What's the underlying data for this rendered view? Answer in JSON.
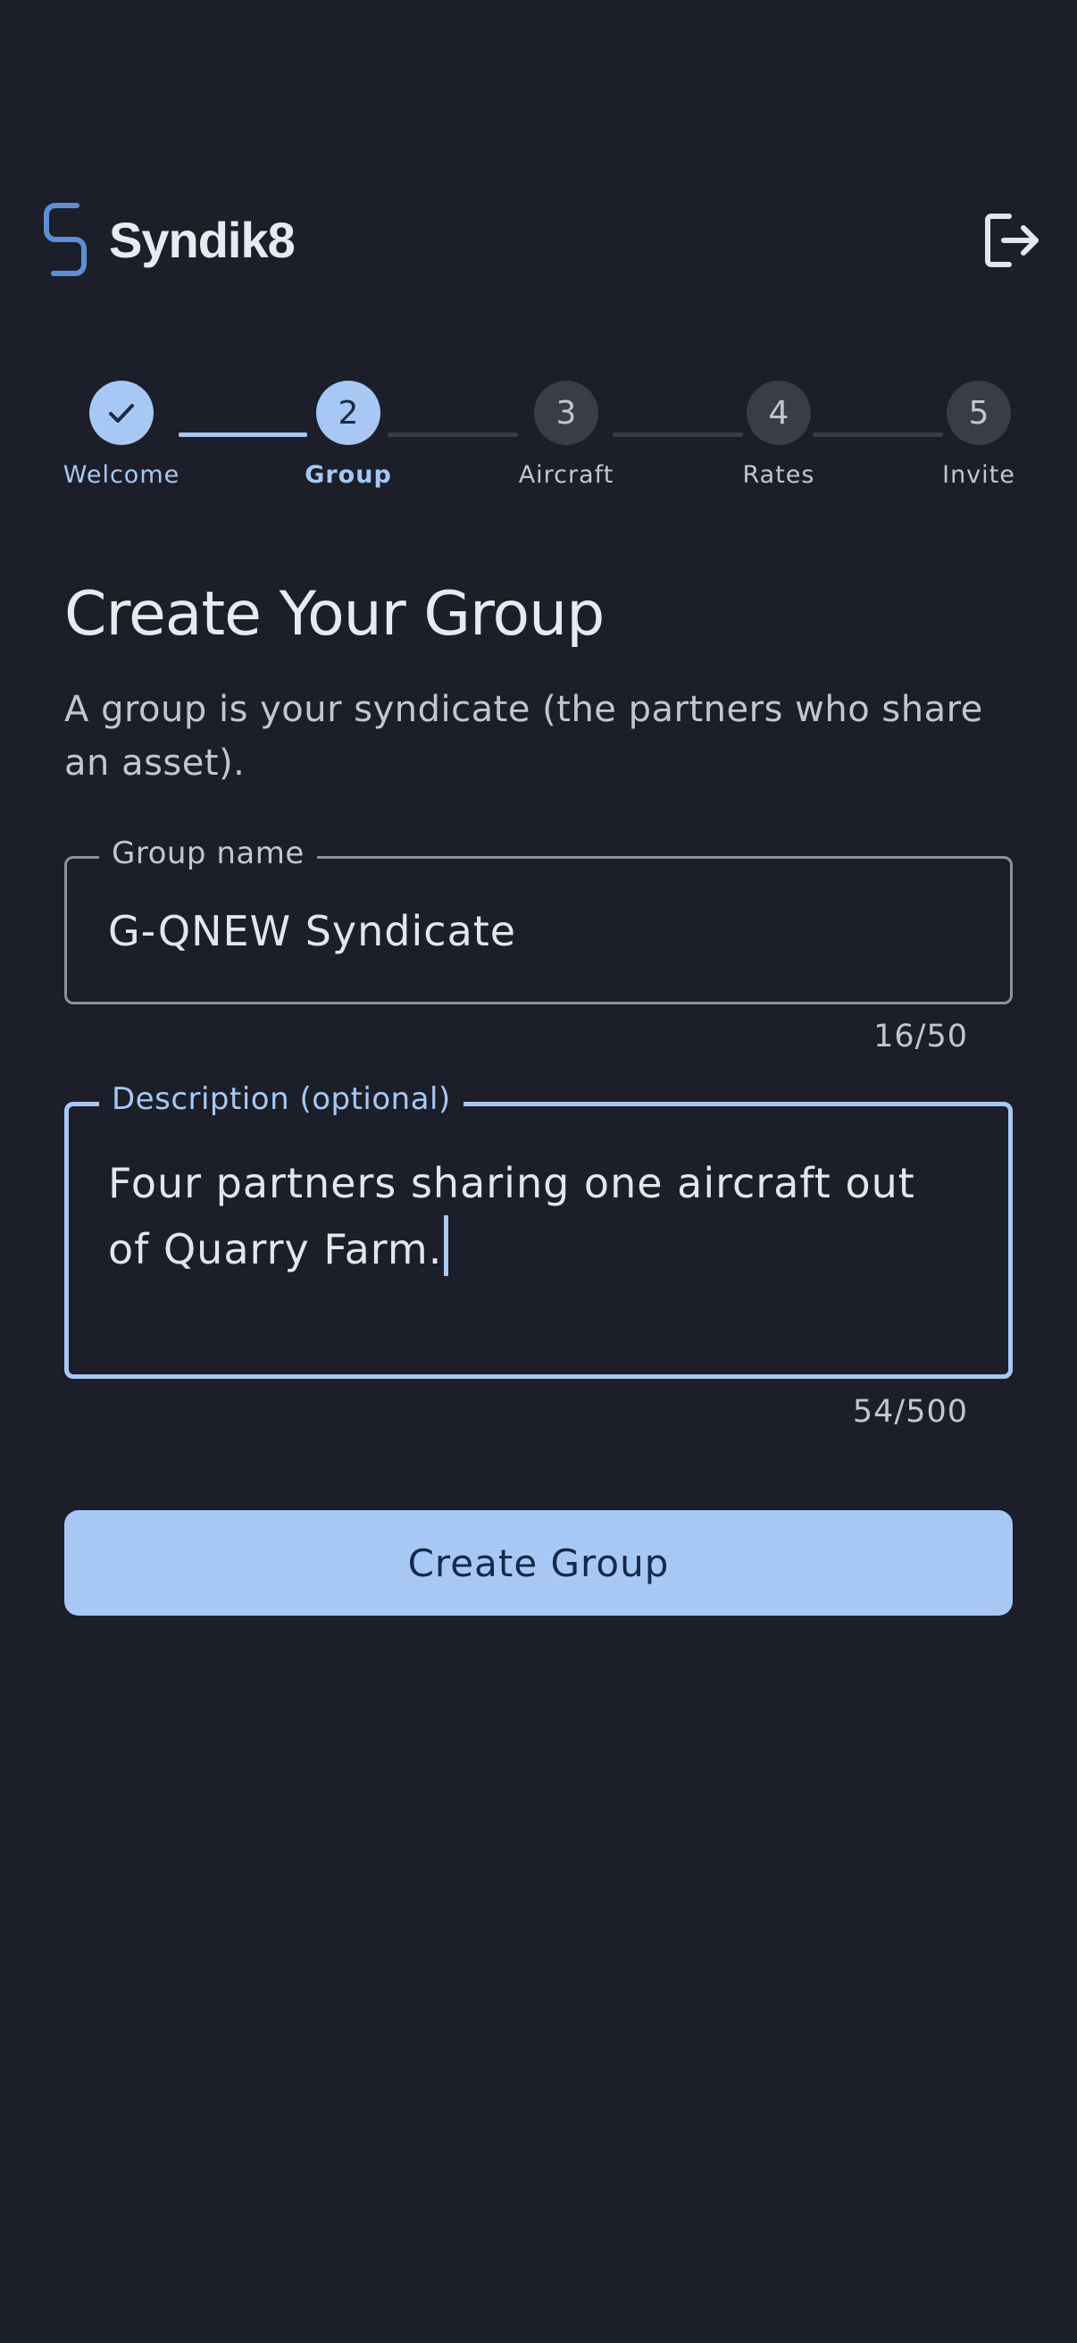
{
  "app": {
    "name": "Syndik8",
    "logo_icon": "chain-link-s-icon",
    "logout_icon": "logout-icon"
  },
  "stepper": {
    "steps": [
      {
        "label": "Welcome",
        "number": "",
        "state": "done"
      },
      {
        "label": "Group",
        "number": "2",
        "state": "active"
      },
      {
        "label": "Aircraft",
        "number": "3",
        "state": "pending"
      },
      {
        "label": "Rates",
        "number": "4",
        "state": "pending"
      },
      {
        "label": "Invite",
        "number": "5",
        "state": "pending"
      }
    ]
  },
  "page": {
    "title": "Create Your Group",
    "subtitle": "A group is your syndicate (the partners who share an asset)."
  },
  "form": {
    "group_name": {
      "label": "Group name",
      "value": "G-QNEW Syndicate",
      "counter": "16/50"
    },
    "description": {
      "label": "Description (optional)",
      "value": "Four partners sharing one aircraft out of Quarry Farm.",
      "counter": "54/500"
    },
    "submit_label": "Create Group"
  },
  "colors": {
    "background": "#1c1f29",
    "accent": "#a7c8f5",
    "inactive_step": "#3a3d46",
    "button_text": "#13294b"
  }
}
